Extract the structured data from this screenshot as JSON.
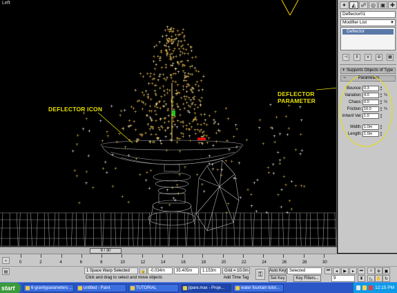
{
  "viewport": {
    "label": "Left",
    "annotation_icon": "DEFLECTOR ICON",
    "annotation_param_line1": "DEFLECTOR",
    "annotation_param_line2": "PARAMETER"
  },
  "command_panel": {
    "tabs": [
      "create-icon",
      "modify-icon",
      "hierarchy-icon",
      "motion-icon",
      "display-icon",
      "utilities-icon"
    ],
    "object_name": "Deflector01",
    "modifier_list": "Modifier List",
    "stack_item": "Deflector",
    "rollout_supports": "Supports Objects of Type",
    "rollout_parameters": "Parameters",
    "params": [
      {
        "label": "Bounce:",
        "value": "0.3",
        "extra": ""
      },
      {
        "label": "Variation:",
        "value": "4.0",
        "extra": "%"
      },
      {
        "label": "Chaos:",
        "value": "0.0",
        "extra": "%"
      },
      {
        "label": "Friction:",
        "value": "10.0",
        "extra": "%"
      },
      {
        "label": "Inherit Vel:",
        "value": "1.0",
        "extra": ""
      },
      {
        "label": "Width:",
        "value": "1.0m",
        "extra": ""
      },
      {
        "label": "Length:",
        "value": "1.0m",
        "extra": ""
      }
    ],
    "accent_color": "#e8e000"
  },
  "timeline": {
    "frame_display": "9 / 30",
    "ticks": [
      "0",
      "2",
      "4",
      "6",
      "8",
      "10",
      "12",
      "14",
      "16",
      "18",
      "20",
      "22",
      "24",
      "26",
      "28",
      "30"
    ]
  },
  "status": {
    "selection": "1 Space Warp Selected",
    "prompt": "Click and drag to select and move objects",
    "x_value": "-0.034m",
    "y_value": "35.405m",
    "z_value": "1.153m",
    "grid": "Grid = 10.0m",
    "add_time_tag": "Add Time Tag",
    "auto_key": "Auto Key",
    "auto_key_mode": "Selected",
    "set_key": "Set Key",
    "key_filters": "Key Filters...",
    "frame_field": "9"
  },
  "taskbar": {
    "start_label": "start",
    "tasks": [
      "6-gravityparameters ...",
      "untitled - Paint",
      "TUTORIAL",
      "jipare.max - Proje...",
      "water fountain tutor..."
    ],
    "clock": "12:15 PM"
  }
}
